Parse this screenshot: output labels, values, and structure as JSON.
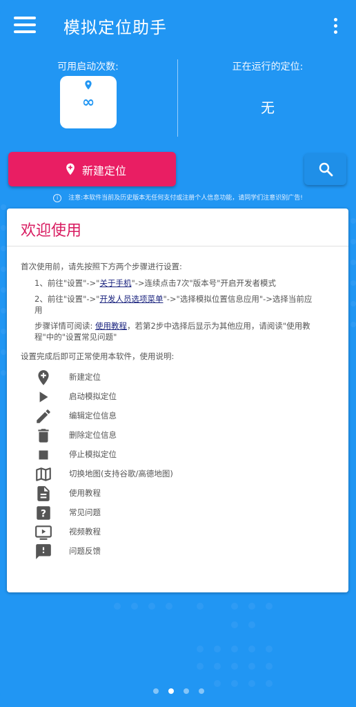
{
  "app": {
    "title": "模拟定位助手"
  },
  "stats": {
    "launches_label": "可用启动次数:",
    "launches_value": "∞",
    "running_label": "正在运行的定位:",
    "running_value": "无"
  },
  "actions": {
    "new_location": "新建定位"
  },
  "notice": "注意:本软件当前及历史版本无任何支付或注册个人信息功能，请同学们注意识别广告!",
  "welcome": {
    "title": "欢迎使用",
    "intro": "首次使用前，请先按照下方两个步骤进行设置:",
    "step1_a": "1、前往\"设置\"->\"",
    "step1_link": "关于手机",
    "step1_b": "\"->连续点击7次\"版本号\"开启开发者模式",
    "step2_a": "2、前往\"设置\"->\"",
    "step2_link": "开发人员选项菜单",
    "step2_b": "\"->\"选择模拟位置信息应用\"->选择当前应",
    "step2_c": "用",
    "detail_a": "步骤详情可阅读: ",
    "detail_link": "使用教程",
    "detail_b": "，若第2步中选择后显示为其他应用，请阅读\"使用教",
    "detail_c": "程\"中的\"设置常见问题\"",
    "usage_intro": "设置完成后即可正常使用本软件，使用说明:",
    "legend": [
      {
        "icon": "add-location-icon",
        "label": "新建定位"
      },
      {
        "icon": "play-icon",
        "label": "启动模拟定位"
      },
      {
        "icon": "edit-icon",
        "label": "编辑定位信息"
      },
      {
        "icon": "delete-icon",
        "label": "删除定位信息"
      },
      {
        "icon": "stop-icon",
        "label": "停止模拟定位"
      },
      {
        "icon": "map-icon",
        "label": "切换地图(支持谷歌/高德地图)"
      },
      {
        "icon": "document-icon",
        "label": "使用教程"
      },
      {
        "icon": "help-icon",
        "label": "常见问题"
      },
      {
        "icon": "video-icon",
        "label": "视频教程"
      },
      {
        "icon": "feedback-icon",
        "label": "问题反馈"
      }
    ]
  },
  "pager": {
    "count": 4,
    "active": 1
  },
  "colors": {
    "primary": "#2196F3",
    "accent": "#E91E63",
    "title_accent": "#D81B60"
  }
}
